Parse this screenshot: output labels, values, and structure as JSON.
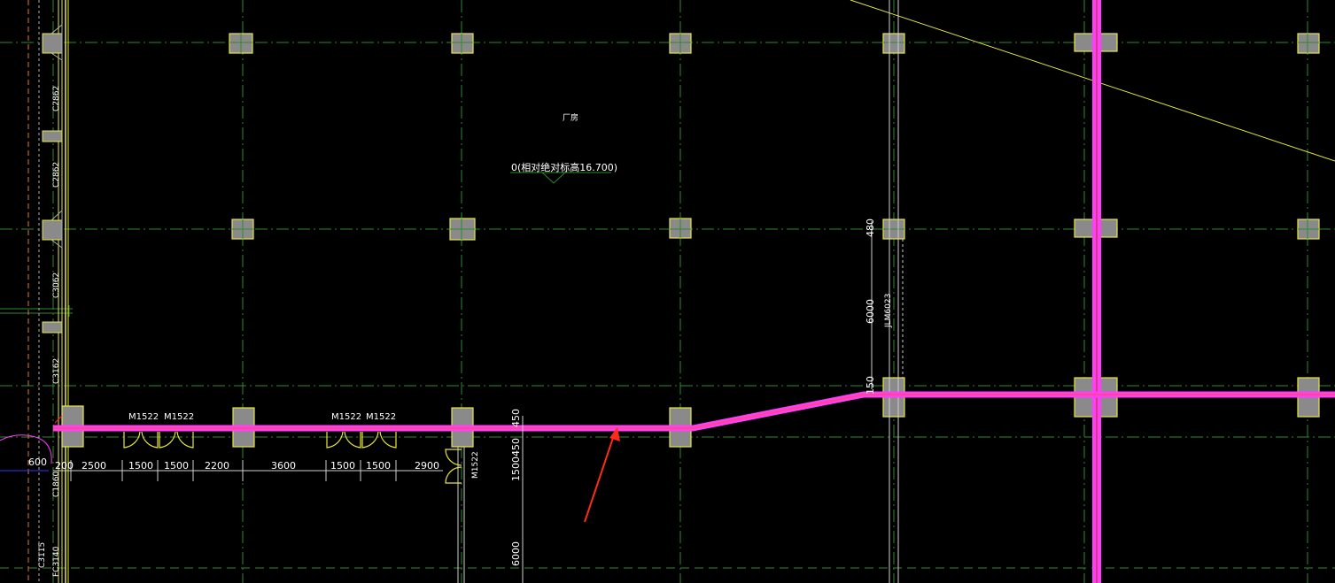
{
  "room": {
    "name": "厂房",
    "elevation_label": "0(相对绝对标高16.700)"
  },
  "doors": {
    "m1522": "M1522"
  },
  "windows": {
    "c2862": "C2862",
    "c3062": "C3062",
    "c3162": "C3162",
    "c1860": "C1860",
    "c3115": "C3115",
    "fc3140": "FC3140"
  },
  "tag_jlm": "JLM6023",
  "dims": {
    "d600": "600",
    "d200": "200",
    "d2500": "2500",
    "d1500": "1500",
    "d2200": "2200",
    "d3600": "3600",
    "d2900": "2900",
    "d450": "450",
    "d150": "150",
    "d6000": "6000",
    "d480": "480",
    "d1500450": "1500450"
  },
  "colors": {
    "background": "#000000",
    "grid_line": "#2f8a2f",
    "column_fill": "#8a8a8a",
    "column_edge": "#e6e64a",
    "wall_magenta": "#ff3cff",
    "wall_core": "#d0406a",
    "yellow_line": "#e8e83a",
    "arrow_red": "#ff2a1a",
    "dim_text": "#ffffff",
    "white_line": "#d0d0d0"
  }
}
